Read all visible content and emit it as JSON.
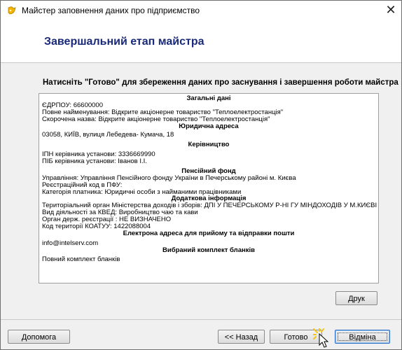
{
  "window": {
    "title": "Майстер заповнення даних про підприємство",
    "close_glyph": "✕",
    "icon": "wizard-icon"
  },
  "header": {
    "heading": "Завершальний етап майстра"
  },
  "content": {
    "instruction": "Натисніть \"Готово\" для збереження даних про заснування і завершення роботи майстра",
    "summary": {
      "general_title": "Загальні дані",
      "edrpou": "ЄДРПОУ: 66600000",
      "full_name": "Повне найменування: Відкрите акціонерне товариство \"Теплоелектростанція\"",
      "short_name": "Скорочена назва: Відкрите акціонерне товариство \"Теплоелектростанція\"",
      "legal_address_title": "Юридична адреса",
      "address": "03058, КИЇВ, вулиця Лебедева- Кумача, 18",
      "management_title": "Керівництво",
      "head_inn": "ІПН керівника установи: 3336669990",
      "head_name": "ПІБ керівника установи: Іванов І.І.",
      "pension_title": "Пенсійний фонд",
      "pension_office": "Управління: Управління  Пенсійного фонду України  в  Печерському районі м. Києва",
      "pfu_code": "Реєстраційний код в ПФУ:",
      "payer_category": "Категорія платника: Юридичні особи з найманими працівниками",
      "additional_title": "Додаткова інформація",
      "tax_office": "Територіальний орган Міністерства доходів і зборів: ДПІ У ПЕЧЕРСЬКОМУ Р-НІ ГУ МІНДОХОДІВ У М.КИЄВІ",
      "kved": "Вид діяльності за КВЕД: Виробництво чаю та кави",
      "reg_authority": "Орган держ. реєстрації : НЕ ВИЗНАЧЕНО",
      "koatuu": "Код території КОАТУУ: 1422088004",
      "email_title": "Електрона адреса для прийому та відправки пошти",
      "email": "info@intelserv.com",
      "forms_title": "Вибраний комплект бланків",
      "forms_value": "Повний комплект бланків"
    },
    "print_button": "Друк"
  },
  "footer": {
    "help_button": "Допомога",
    "back_button": "<< Назад",
    "finish_button": "Готово",
    "cancel_button": "Відміна"
  },
  "colors": {
    "heading": "#1a2a7a",
    "default_button_border": "#2f6fc4"
  }
}
